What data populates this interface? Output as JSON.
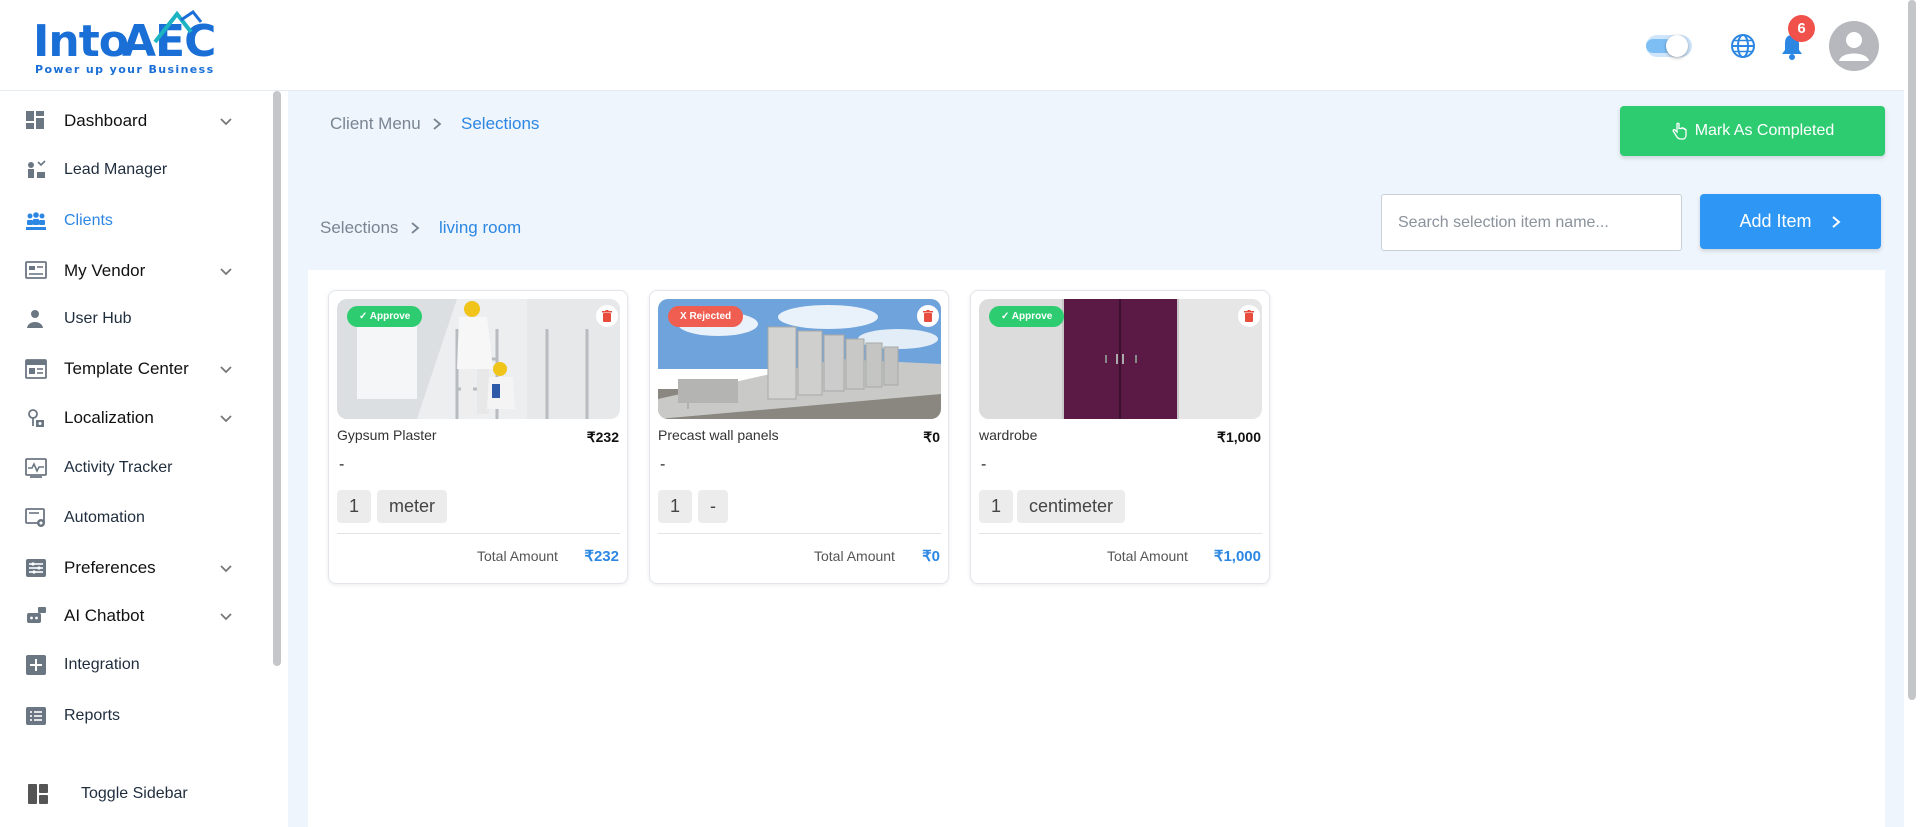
{
  "brand": {
    "name_part1": "Into",
    "name_part2": "AEC",
    "tagline": "Power up your Business"
  },
  "header": {
    "notification_count": "6"
  },
  "sidebar": {
    "items": [
      {
        "label": "Dashboard",
        "icon": "dashboard-icon",
        "has_submenu": true
      },
      {
        "label": "Lead Manager",
        "icon": "lead-manager-icon",
        "has_submenu": false
      },
      {
        "label": "Clients",
        "icon": "clients-icon",
        "has_submenu": false,
        "active": true
      },
      {
        "label": "My Vendor",
        "icon": "vendor-icon",
        "has_submenu": true
      },
      {
        "label": "User Hub",
        "icon": "user-icon",
        "has_submenu": false
      },
      {
        "label": "Template Center",
        "icon": "template-icon",
        "has_submenu": true
      },
      {
        "label": "Localization",
        "icon": "localization-icon",
        "has_submenu": true
      },
      {
        "label": "Activity Tracker",
        "icon": "activity-icon",
        "has_submenu": false
      },
      {
        "label": "Automation",
        "icon": "automation-icon",
        "has_submenu": false
      },
      {
        "label": "Preferences",
        "icon": "preferences-icon",
        "has_submenu": true
      },
      {
        "label": "AI Chatbot",
        "icon": "chatbot-icon",
        "has_submenu": true
      },
      {
        "label": "Integration",
        "icon": "integration-icon",
        "has_submenu": false
      },
      {
        "label": "Reports",
        "icon": "reports-icon",
        "has_submenu": false
      }
    ],
    "toggle_label": "Toggle Sidebar"
  },
  "breadcrumb_top": {
    "parent": "Client Menu",
    "current": "Selections"
  },
  "breadcrumb_sub": {
    "parent": "Selections",
    "current": "living room"
  },
  "actions": {
    "mark_completed_label": "Mark As Completed",
    "add_item_label": "Add Item",
    "search_placeholder": "Search selection item name..."
  },
  "cards": [
    {
      "name": "Gypsum Plaster",
      "price": "₹232",
      "status": "✓ Approve",
      "status_type": "approve",
      "description": "-",
      "quantity": "1",
      "unit": "meter",
      "total_label": "Total Amount",
      "total": "₹232"
    },
    {
      "name": "Precast wall panels",
      "price": "₹0",
      "status": "X Rejected",
      "status_type": "rejected",
      "description": "-",
      "quantity": "1",
      "unit": "-",
      "total_label": "Total Amount",
      "total": "₹0"
    },
    {
      "name": "wardrobe",
      "price": "₹1,000",
      "status": "✓ Approve",
      "status_type": "approve",
      "description": "-",
      "quantity": "1",
      "unit": "centimeter",
      "total_label": "Total Amount",
      "total": "₹1,000"
    }
  ],
  "colors": {
    "accent": "#2c87e3",
    "approve": "#2ecc71",
    "rejected": "#ef5e50",
    "add_button": "#2e96f5"
  }
}
